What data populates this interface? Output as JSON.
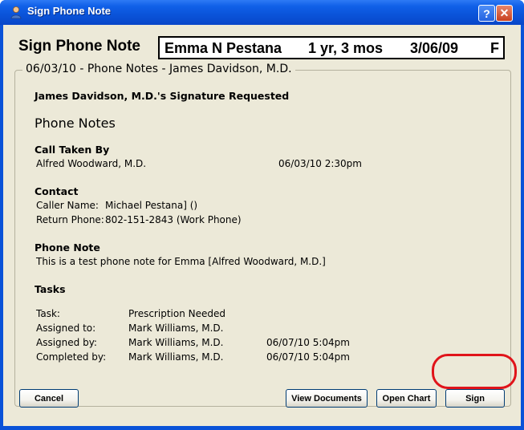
{
  "window": {
    "title": "Sign Phone Note",
    "help_label": "?",
    "close_label": "✕"
  },
  "header": {
    "title": "Sign Phone Note",
    "patient": {
      "name": "Emma N Pestana",
      "age": "1 yr, 3 mos",
      "dob": "3/06/09",
      "sex": "F"
    }
  },
  "note": {
    "legend": "06/03/10 - Phone Notes - James Davidson, M.D.",
    "signature_request": "James Davidson, M.D.'s Signature Requested",
    "heading": "Phone Notes",
    "call_taken_by": {
      "label": "Call Taken By",
      "name": "Alfred Woodward, M.D.",
      "datetime": "06/03/10 2:30pm"
    },
    "contact": {
      "label": "Contact",
      "caller_label": "Caller Name:",
      "caller_value": "Michael Pestana] ()",
      "phone_label": "Return Phone:",
      "phone_value": "802-151-2843 (Work Phone)"
    },
    "phone_note": {
      "label": "Phone Note",
      "text": "This is a test phone note for Emma [Alfred Woodward, M.D.]"
    },
    "tasks": {
      "label": "Tasks",
      "task_label": "Task:",
      "task_value": "Prescription Needed",
      "assigned_to_label": "Assigned to:",
      "assigned_to_value": "Mark Williams, M.D.",
      "assigned_by_label": "Assigned by:",
      "assigned_by_value": "Mark Williams, M.D.",
      "assigned_by_date": "06/07/10 5:04pm",
      "completed_by_label": "Completed by:",
      "completed_by_value": "Mark Williams, M.D.",
      "completed_by_date": "06/07/10 5:04pm"
    }
  },
  "buttons": {
    "cancel": "Cancel",
    "view_documents": "View Documents",
    "open_chart": "Open Chart",
    "sign": "Sign"
  }
}
